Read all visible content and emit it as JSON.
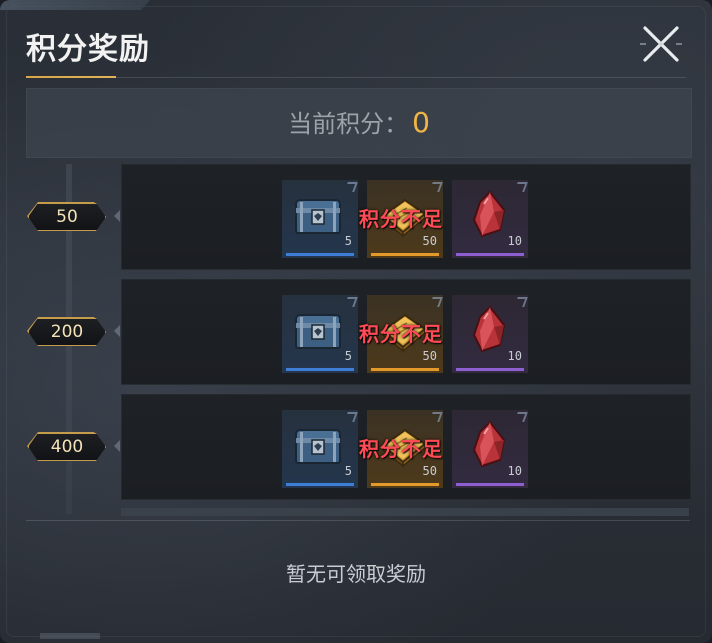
{
  "dialog": {
    "title": "积分奖励",
    "close_icon": "close-x-icon"
  },
  "score": {
    "label": "当前积分：",
    "value": "0"
  },
  "tiers": [
    {
      "threshold": "50",
      "status": "积分不足",
      "items": [
        {
          "icon": "chest-icon",
          "rarity": "blue",
          "count": "5"
        },
        {
          "icon": "book-icon",
          "rarity": "orange",
          "count": "50"
        },
        {
          "icon": "crystal-icon",
          "rarity": "purple",
          "count": "10"
        }
      ]
    },
    {
      "threshold": "200",
      "status": "积分不足",
      "items": [
        {
          "icon": "chest-icon",
          "rarity": "blue",
          "count": "5"
        },
        {
          "icon": "book-icon",
          "rarity": "orange",
          "count": "50"
        },
        {
          "icon": "crystal-icon",
          "rarity": "purple",
          "count": "10"
        }
      ]
    },
    {
      "threshold": "400",
      "status": "积分不足",
      "items": [
        {
          "icon": "chest-icon",
          "rarity": "blue",
          "count": "5"
        },
        {
          "icon": "book-icon",
          "rarity": "orange",
          "count": "50"
        },
        {
          "icon": "crystal-icon",
          "rarity": "purple",
          "count": "10"
        }
      ]
    }
  ],
  "footer": {
    "text": "暂无可领取奖励"
  },
  "colors": {
    "accent_gold": "#f0b446",
    "insufficient_red": "#ff4b55",
    "rarity_blue": "#3f7ed6",
    "rarity_orange": "#e39a2b",
    "rarity_purple": "#8e5fd0"
  }
}
